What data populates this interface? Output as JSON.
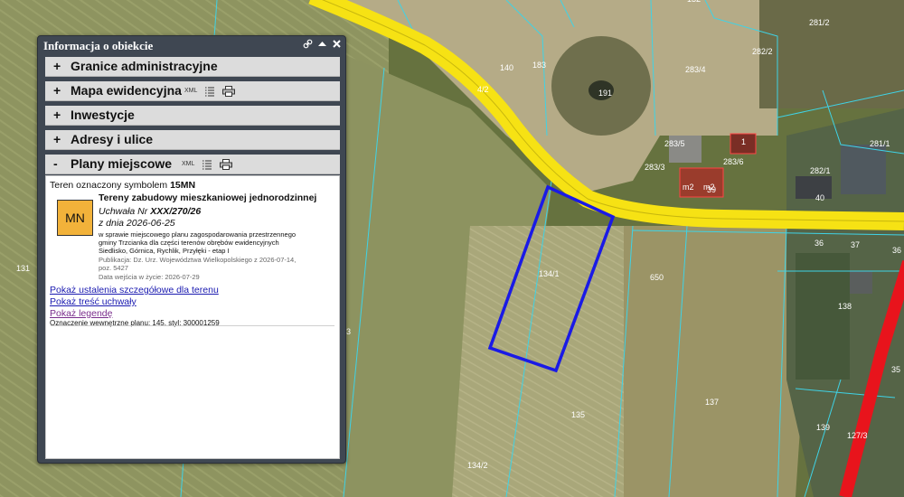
{
  "panel": {
    "title": "Informacja o obiekcie",
    "tools": {
      "link_icon": "link-icon",
      "collapse_icon": "triangle-up-icon",
      "close_icon": "close-x-icon"
    }
  },
  "sections": [
    {
      "toggle": "+",
      "title": "Granice administracyjne",
      "has_tools": false
    },
    {
      "toggle": "+",
      "title": "Mapa ewidencyjna",
      "has_tools": true,
      "xml": "XML"
    },
    {
      "toggle": "+",
      "title": "Inwestycje",
      "has_tools": false
    },
    {
      "toggle": "+",
      "title": "Adresy i ulice",
      "has_tools": false
    },
    {
      "toggle": "-",
      "title": "Plany miejscowe",
      "has_tools": true,
      "xml": "XML"
    }
  ],
  "plan": {
    "symbol_prefix": "Teren oznaczony symbolem",
    "symbol": "15MN",
    "badge": "MN",
    "heading": "Tereny zabudowy mieszkaniowej jednorodzinnej",
    "resolution_prefix": "Uchwała Nr",
    "resolution_number": "XXX/270/26",
    "resolution_date": "z dnia 2026-06-25",
    "description_lines": [
      "w sprawie miejscowego planu zagospodarowania przestrzennego",
      "gminy Trzcianka dla części terenów obrębów ewidencyjnych",
      "Siedlisko, Górnica, Rychlik, Przyłęki - etap I"
    ],
    "publication_lines": [
      "Publikacja: Dz. Urz. Województwa Wielkopolskiego z 2026-07-14,",
      "poz. 5427"
    ],
    "effective": "Data wejścia w życie: 2026-07-29",
    "links": [
      "Pokaż ustalenia szczegółowe dla terenu",
      "Pokaż treść uchwały",
      "Pokaż legendę"
    ],
    "internal_id": "Oznaczenie wewnętrzne planu: 145, styl: 300001259"
  },
  "map": {
    "road_color": "#f6e214",
    "road_red_color": "#e8141c",
    "selection_color": "#1a1ae6",
    "parcel_line_color": "#3fd3e6",
    "parcels": [
      "131",
      "140",
      "183",
      "4/2",
      "191",
      "132",
      "281/2",
      "282/2",
      "283/4",
      "283/5",
      "283/3",
      "283/6",
      "1",
      "m2",
      "m2",
      "39",
      "281/1",
      "282/1",
      "40",
      "134/1",
      "650",
      "137",
      "135",
      "134/2",
      "138",
      "139",
      "127/3",
      "36",
      "37",
      "36",
      "35",
      "3"
    ]
  }
}
